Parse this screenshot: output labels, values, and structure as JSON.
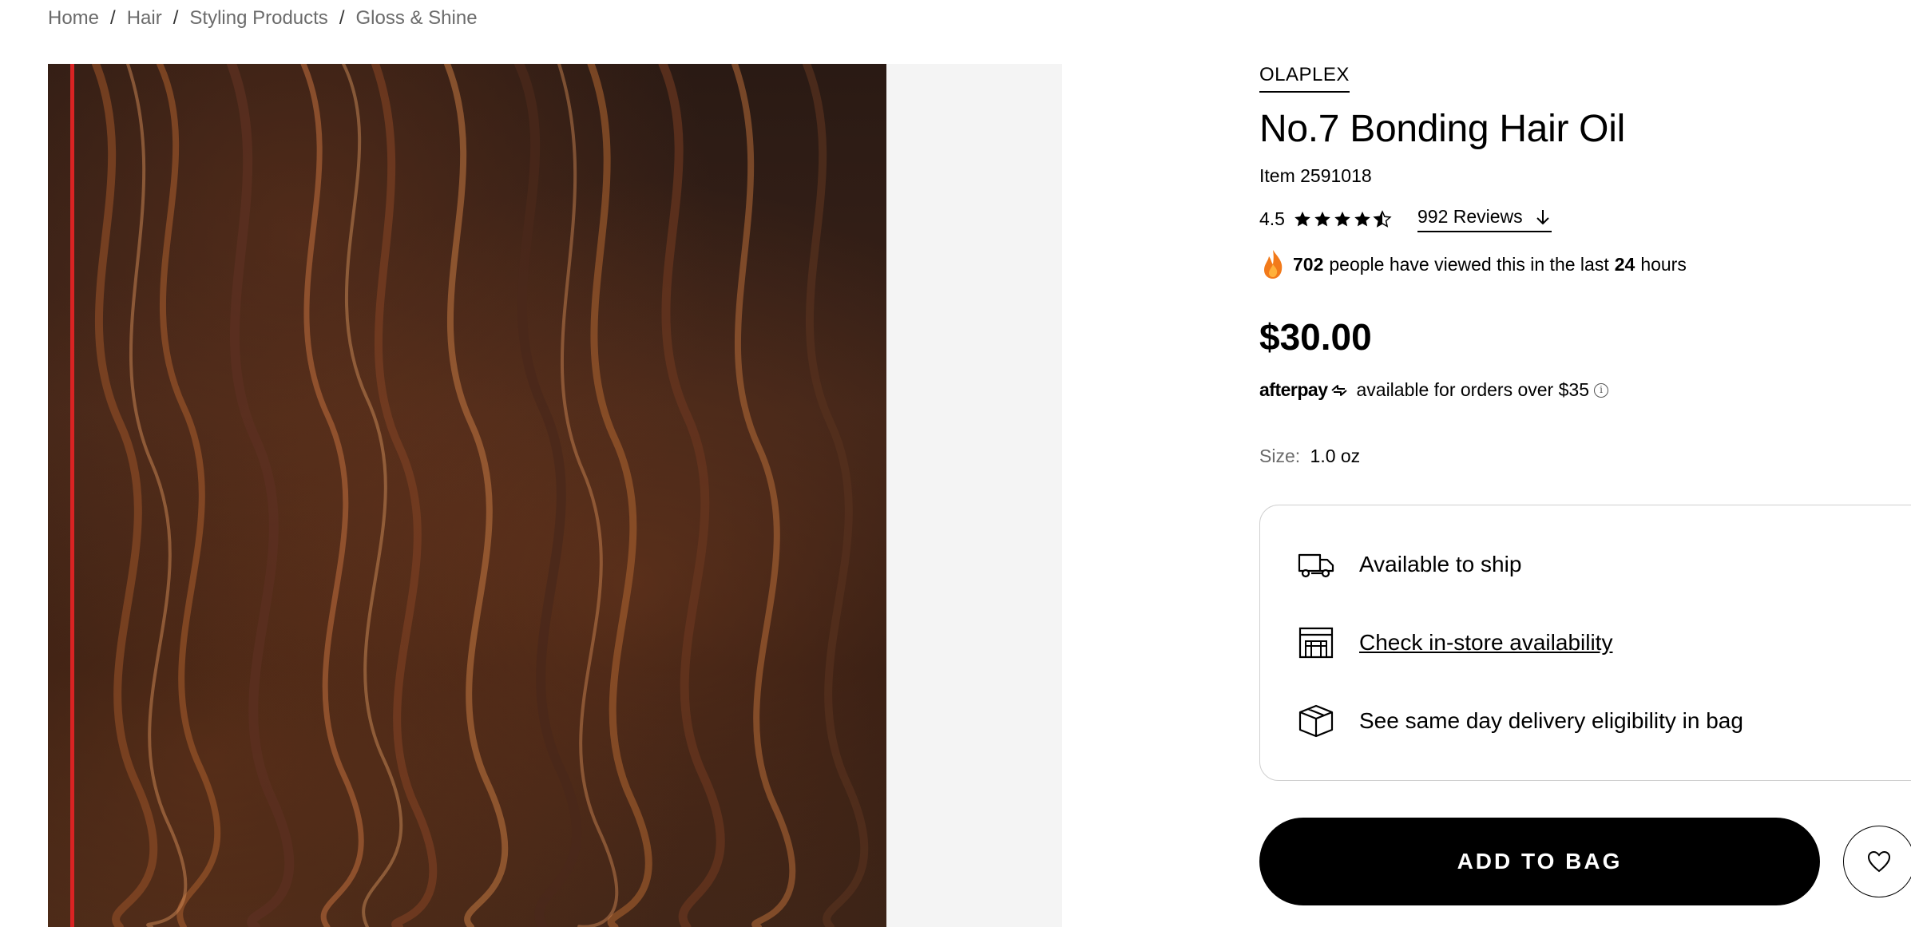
{
  "breadcrumb": {
    "items": [
      "Home",
      "Hair",
      "Styling Products",
      "Gloss & Shine"
    ],
    "separator": "/"
  },
  "product": {
    "brand": "OLAPLEX",
    "title": "No.7 Bonding Hair Oil",
    "item_number": "Item 2591018",
    "rating": "4.5",
    "rating_value": 4.5,
    "reviews_label": "992 Reviews",
    "views_count": "702",
    "views_text_mid": "people have viewed this in the last",
    "views_hours": "24",
    "views_text_end": "hours",
    "price": "$30.00",
    "afterpay_brand": "afterpay",
    "afterpay_text": "available for orders over $35",
    "size_label": "Size:",
    "size_value": "1.0 oz"
  },
  "fulfillment": {
    "ship": "Available to ship",
    "instore": "Check in-store availability",
    "sameday": "See same day delivery eligibility in bag"
  },
  "actions": {
    "add_to_bag": "ADD TO BAG"
  },
  "icons": {
    "rating": "star-icon",
    "reviews": "arrow-down-icon",
    "views": "flame-icon",
    "ship": "truck-icon",
    "store": "store-icon",
    "delivery": "box-icon",
    "wishlist": "heart-icon",
    "afterpay_info": "info-icon"
  },
  "colors": {
    "accent_red": "#d92323",
    "button": "#000000",
    "muted_text": "#6b6b6b"
  }
}
